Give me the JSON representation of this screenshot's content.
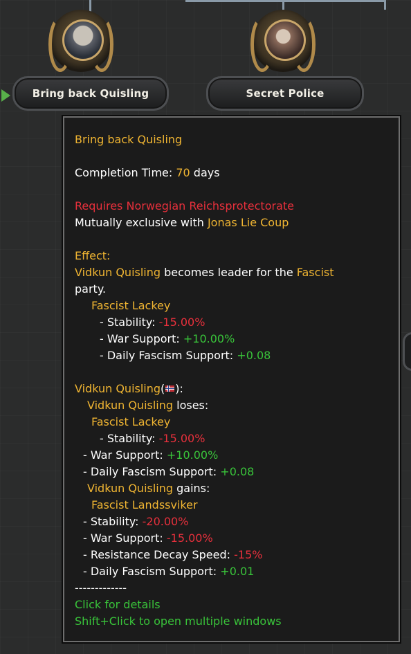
{
  "focus_tree": {
    "nodes": [
      {
        "label": "Bring back Quisling",
        "icon": "quisling-portrait-icon"
      },
      {
        "label": "Secret Police",
        "icon": "secret-police-icon"
      }
    ]
  },
  "tooltip": {
    "title": "Bring back Quisling",
    "completion_label": "Completion Time: ",
    "completion_value": "70",
    "completion_unit": " days",
    "requires": "Requires Norwegian Reichsprotectorate",
    "exclusive_label": "Mutually exclusive with ",
    "exclusive_value": "Jonas Lie Coup",
    "effect_label": "Effect:",
    "effect_leader": "Vidkun Quisling",
    "effect_mid": " becomes leader for the ",
    "effect_party": "Fascist",
    "effect_party_end": "party.",
    "trait1_name": "Fascist Lackey",
    "trait1_stab_label": "- Stability: ",
    "trait1_stab_val": "-15.00%",
    "trait1_war_label": "- War Support: ",
    "trait1_war_val": "+10.00%",
    "trait1_fasc_label": "- Daily Fascism Support: ",
    "trait1_fasc_val": "+0.08",
    "leader_header": "Vidkun Quisling",
    "leader_header_open": "(",
    "leader_header_close": "):",
    "loses_name": "Vidkun Quisling",
    "loses_label": " loses:",
    "lose_trait": "Fascist Lackey",
    "lose_stab_label": "- Stability: ",
    "lose_stab_val": "-15.00%",
    "lose_war_label": "- War Support: ",
    "lose_war_val": "+10.00%",
    "lose_fasc_label": "- Daily Fascism Support: ",
    "lose_fasc_val": "+0.08",
    "gains_name": "Vidkun Quisling",
    "gains_label": " gains:",
    "gain_trait": "Fascist Landssviker",
    "gain_stab_label": "- Stability: ",
    "gain_stab_val": "-20.00%",
    "gain_war_label": "- War Support: ",
    "gain_war_val": "-15.00%",
    "gain_res_label": "- Resistance Decay Speed: ",
    "gain_res_val": "-15%",
    "gain_fasc_label": "- Daily Fascism Support: ",
    "gain_fasc_val": "+0.01",
    "divider": "-------------",
    "hint1": "Click for details",
    "hint2": "Shift+Click to open multiple windows"
  }
}
